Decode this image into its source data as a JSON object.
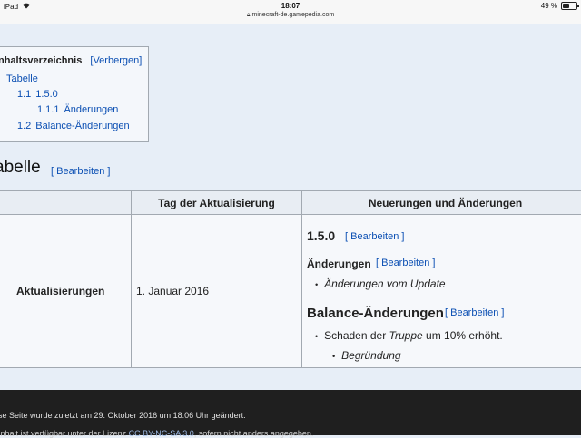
{
  "status_bar": {
    "device": "iPad",
    "wifi_icon": "wifi-icon",
    "time": "18:07",
    "url": "minecraft-de.gamepedia.com",
    "battery": "49 %",
    "battery_level_percent": 49
  },
  "toc": {
    "title": "nhaltsverzeichnis",
    "toggle": "[Verbergen]",
    "items": [
      {
        "number": "",
        "label": "Tabelle"
      },
      {
        "number": "1.1",
        "label": "1.5.0"
      },
      {
        "number": "1.1.1",
        "label": "Änderungen"
      },
      {
        "number": "1.2",
        "label": "Balance-Änderungen"
      }
    ]
  },
  "section": {
    "title": "abelle",
    "edit": "[ Bearbeiten ]"
  },
  "table": {
    "headers": [
      "",
      "Tag der Aktualisierung",
      "Neuerungen und Änderungen"
    ],
    "row": {
      "label": "Aktualisierungen",
      "date": "1. Januar 2016",
      "content": {
        "h_version": "1.5.0",
        "edit1": "[ Bearbeiten ]",
        "h_changes": "Änderungen",
        "edit2": "[ Bearbeiten ]",
        "changes_bullet": "Änderungen vom Update",
        "h_balance": "Balance-Änderungen",
        "edit3": "[ Bearbeiten ]",
        "balance_bullet_pre": "Schaden der ",
        "balance_bullet_em": "Truppe",
        "balance_bullet_post": " um 10% erhöht.",
        "sub_bullet": "Begründung"
      }
    }
  },
  "footer": {
    "last_edit": "se Seite wurde zuletzt am 29. Oktober 2016 um 18:06 Uhr geändert.",
    "license_pre": "Inhalt ist verfügbar unter der Lizenz ",
    "license_link": "CC BY-NC-SA 3.0",
    "license_post": ", sofern nicht anders angegeben."
  }
}
